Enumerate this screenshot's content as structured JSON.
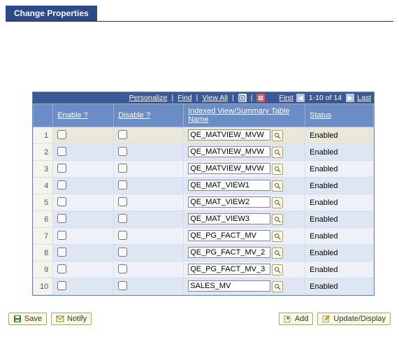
{
  "title": "Change Properties",
  "topbar": {
    "personalize": "Personalize",
    "find": "Find",
    "view_all": "View All",
    "first": "First",
    "range": "1-10 of 14",
    "last": "Last"
  },
  "columns": {
    "enable": "Enable ?",
    "disable": "Disable ?",
    "name": "Indexed View/Summary Table Name",
    "status": "Status"
  },
  "rows": [
    {
      "num": "1",
      "enable": false,
      "disable": false,
      "name": "QE_MATVIEW_MVW",
      "status": "Enabled"
    },
    {
      "num": "2",
      "enable": false,
      "disable": false,
      "name": "QE_MATVIEW_MVW",
      "status": "Enabled"
    },
    {
      "num": "3",
      "enable": false,
      "disable": false,
      "name": "QE_MATVIEW_MVW",
      "status": "Enabled"
    },
    {
      "num": "4",
      "enable": false,
      "disable": false,
      "name": "QE_MAT_VIEW1",
      "status": "Enabled"
    },
    {
      "num": "5",
      "enable": false,
      "disable": false,
      "name": "QE_MAT_VIEW2",
      "status": "Enabled"
    },
    {
      "num": "6",
      "enable": false,
      "disable": false,
      "name": "QE_MAT_VIEW3",
      "status": "Enabled"
    },
    {
      "num": "7",
      "enable": false,
      "disable": false,
      "name": "QE_PG_FACT_MV",
      "status": "Enabled"
    },
    {
      "num": "8",
      "enable": false,
      "disable": false,
      "name": "QE_PG_FACT_MV_2",
      "status": "Enabled"
    },
    {
      "num": "9",
      "enable": false,
      "disable": false,
      "name": "QE_PG_FACT_MV_3",
      "status": "Enabled"
    },
    {
      "num": "10",
      "enable": false,
      "disable": false,
      "name": "SALES_MV",
      "status": "Enabled"
    }
  ],
  "buttons": {
    "save": "Save",
    "notify": "Notify",
    "add": "Add",
    "update_display": "Update/Display"
  }
}
